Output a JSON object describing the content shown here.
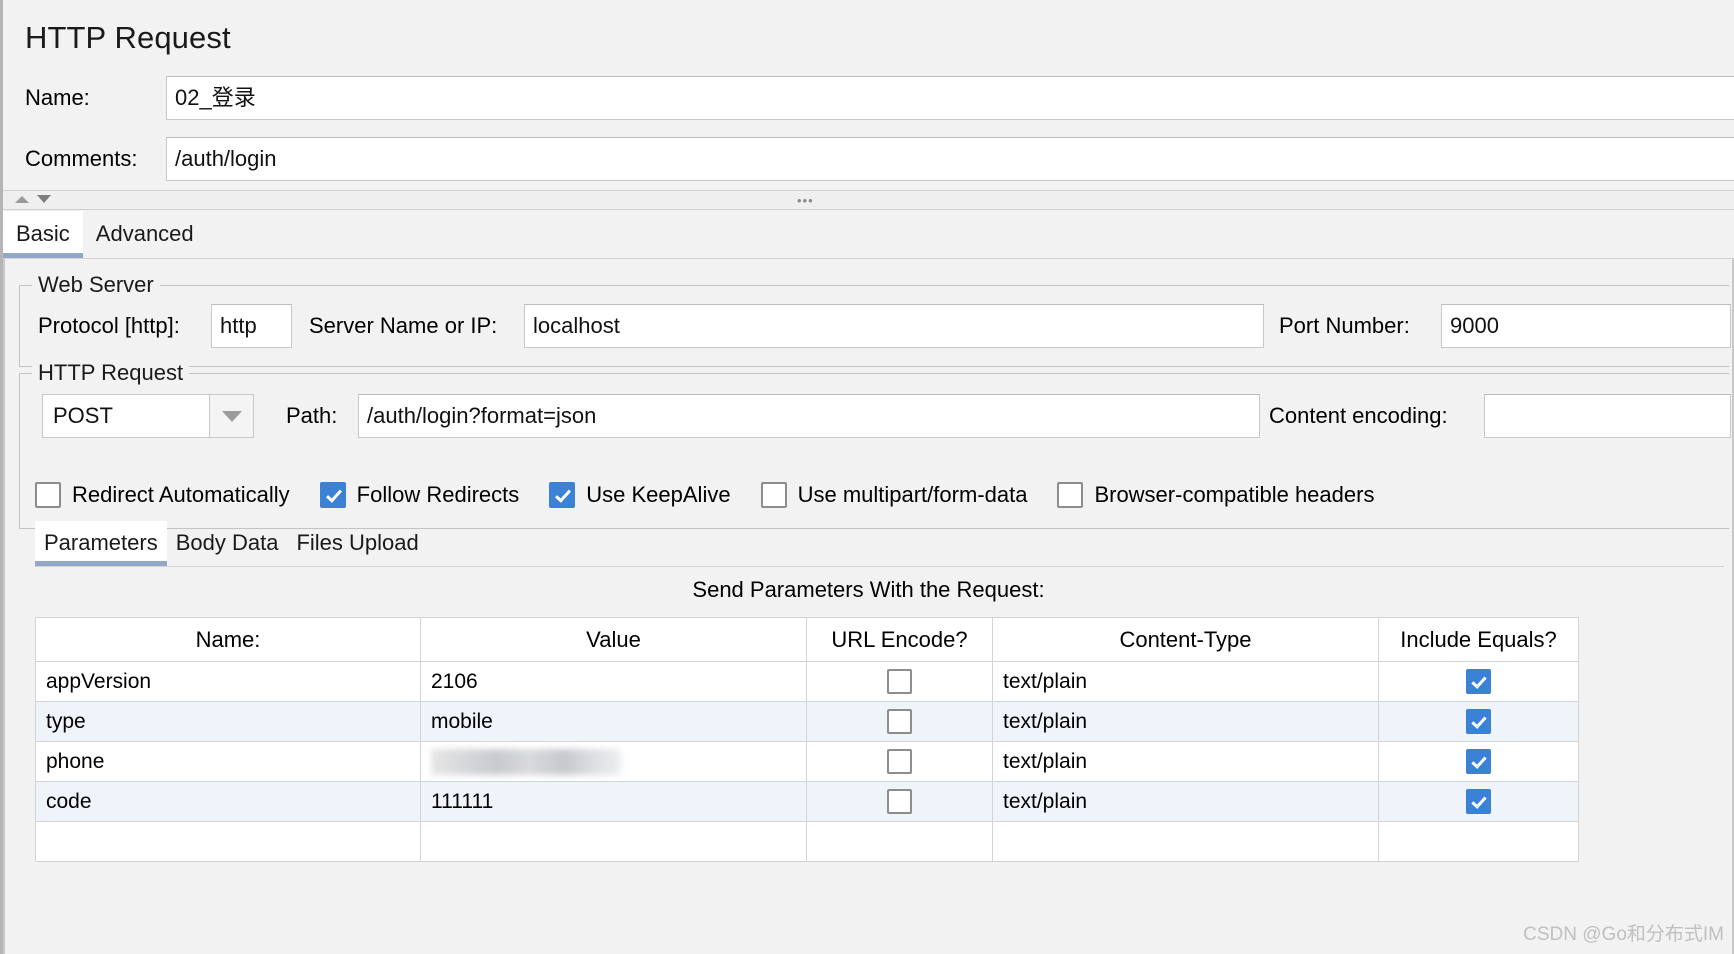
{
  "panel": {
    "title": "HTTP Request",
    "name_label": "Name:",
    "name_value": "02_登录",
    "comments_label": "Comments:",
    "comments_value": "/auth/login"
  },
  "main_tabs": [
    {
      "label": "Basic",
      "selected": true
    },
    {
      "label": "Advanced",
      "selected": false
    }
  ],
  "web_server": {
    "group_title": "Web Server",
    "protocol_label": "Protocol [http]:",
    "protocol_value": "http",
    "server_label": "Server Name or IP:",
    "server_value": "localhost",
    "port_label": "Port Number:",
    "port_value": "9000"
  },
  "http_request": {
    "group_title": "HTTP Request",
    "method_value": "POST",
    "path_label": "Path:",
    "path_value": "/auth/login?format=json",
    "content_encoding_label": "Content encoding:",
    "content_encoding_value": ""
  },
  "checkboxes": [
    {
      "label": "Redirect Automatically",
      "checked": false
    },
    {
      "label": "Follow Redirects",
      "checked": true
    },
    {
      "label": "Use KeepAlive",
      "checked": true
    },
    {
      "label": "Use multipart/form-data",
      "checked": false
    },
    {
      "label": "Browser-compatible headers",
      "checked": false
    }
  ],
  "inner_tabs": [
    {
      "label": "Parameters",
      "selected": true
    },
    {
      "label": "Body Data",
      "selected": false
    },
    {
      "label": "Files Upload",
      "selected": false
    }
  ],
  "params": {
    "caption": "Send Parameters With the Request:",
    "columns": [
      "Name:",
      "Value",
      "URL Encode?",
      "Content-Type",
      "Include Equals?"
    ],
    "rows": [
      {
        "name": "appVersion",
        "value": "2106",
        "value_redacted": false,
        "url_encode": false,
        "content_type": "text/plain",
        "include_equals": true
      },
      {
        "name": "type",
        "value": "mobile",
        "value_redacted": false,
        "url_encode": false,
        "content_type": "text/plain",
        "include_equals": true
      },
      {
        "name": "phone",
        "value": "",
        "value_redacted": true,
        "url_encode": false,
        "content_type": "text/plain",
        "include_equals": true
      },
      {
        "name": "code",
        "value": "111111",
        "value_redacted": false,
        "url_encode": false,
        "content_type": "text/plain",
        "include_equals": true
      },
      {
        "name": "",
        "value": "",
        "value_redacted": false,
        "url_encode": null,
        "content_type": "",
        "include_equals": null
      }
    ]
  },
  "watermark": "CSDN @Go和分布式IM",
  "colors": {
    "accent_checked": "#3b82d6",
    "tab_underline": "#93a8c8",
    "panel_bg": "#f2f2f2",
    "row_alt": "#eff3fa"
  }
}
